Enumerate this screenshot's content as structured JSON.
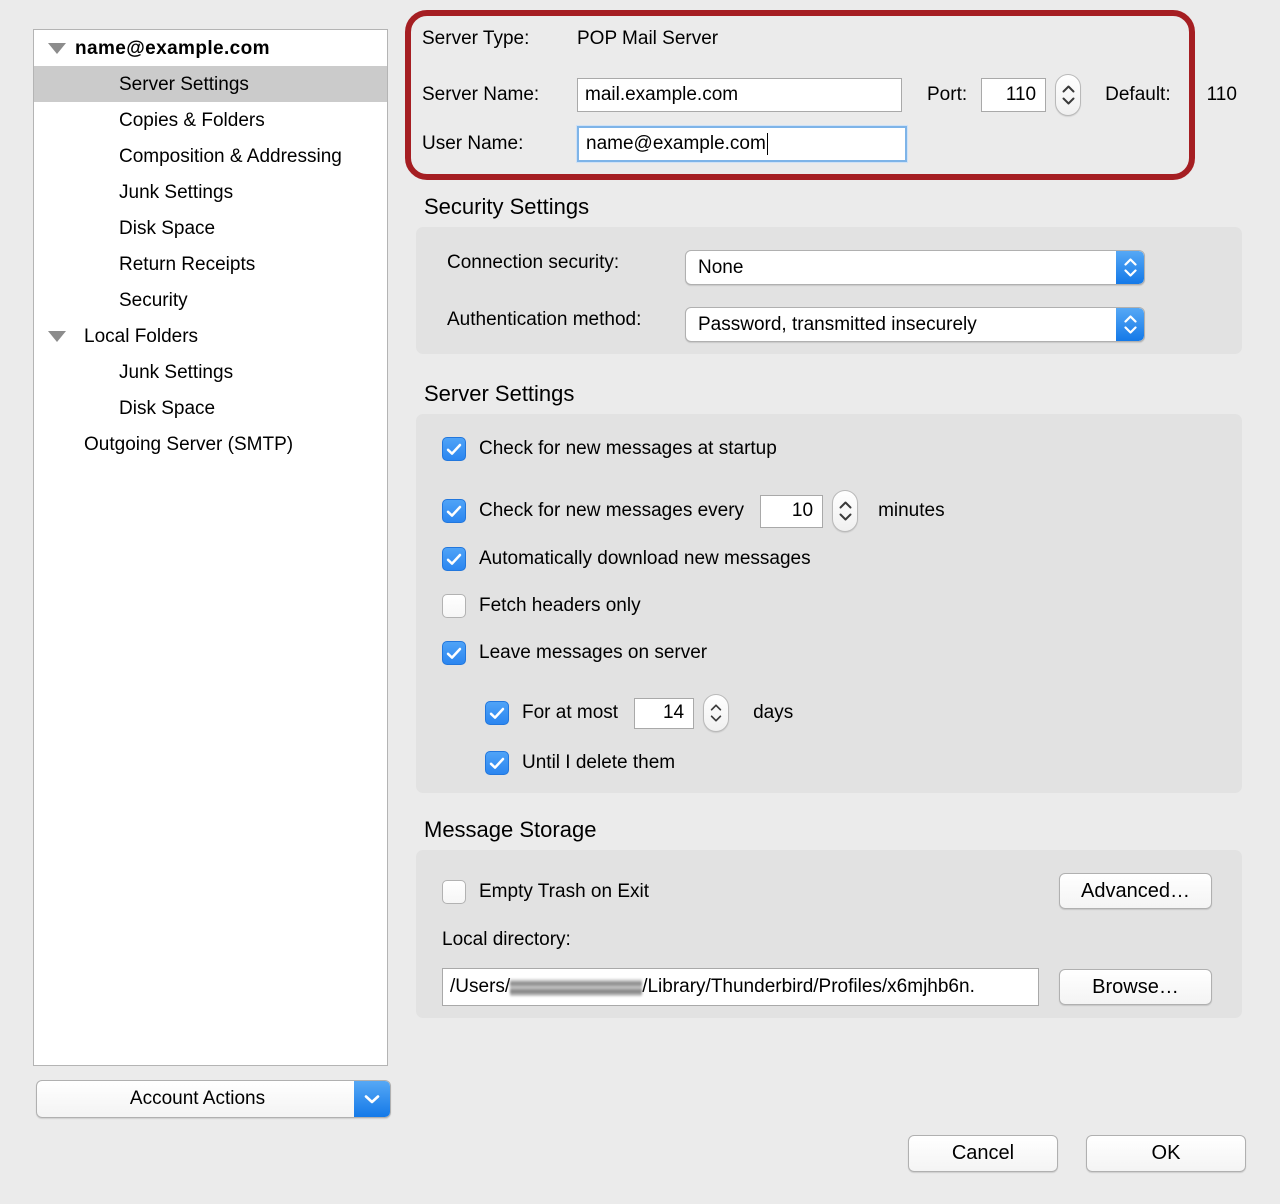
{
  "sidebar": {
    "tree_items": [
      {
        "label": "name@example.com",
        "level": "root",
        "twisty": true,
        "selected": false
      },
      {
        "label": "Server Settings",
        "level": "1",
        "twisty": false,
        "selected": true
      },
      {
        "label": "Copies & Folders",
        "level": "1",
        "twisty": false,
        "selected": false
      },
      {
        "label": "Composition & Addressing",
        "level": "1",
        "twisty": false,
        "selected": false
      },
      {
        "label": "Junk Settings",
        "level": "1",
        "twisty": false,
        "selected": false
      },
      {
        "label": "Disk Space",
        "level": "1",
        "twisty": false,
        "selected": false
      },
      {
        "label": "Return Receipts",
        "level": "1",
        "twisty": false,
        "selected": false
      },
      {
        "label": "Security",
        "level": "1",
        "twisty": false,
        "selected": false
      },
      {
        "label": "Local Folders",
        "level": "0",
        "twisty": true,
        "selected": false
      },
      {
        "label": "Junk Settings",
        "level": "1",
        "twisty": false,
        "selected": false
      },
      {
        "label": "Disk Space",
        "level": "1",
        "twisty": false,
        "selected": false
      },
      {
        "label": "Outgoing Server (SMTP)",
        "level": "0",
        "twisty": false,
        "selected": false
      }
    ],
    "account_actions_label": "Account Actions"
  },
  "server_identity": {
    "server_type_label": "Server Type:",
    "server_type_value": "POP Mail Server",
    "server_name_label": "Server Name:",
    "server_name_value": "mail.example.com",
    "port_label": "Port:",
    "port_value": "110",
    "default_label": "Default:",
    "default_value": "110",
    "user_name_label": "User Name:",
    "user_name_value": "name@example.com"
  },
  "security_settings": {
    "title": "Security Settings",
    "connection_security_label": "Connection security:",
    "connection_security_value": "None",
    "authentication_method_label": "Authentication method:",
    "authentication_method_value": "Password, transmitted insecurely"
  },
  "server_settings": {
    "title": "Server Settings",
    "check_at_startup_label": "Check for new messages at startup",
    "check_at_startup_checked": true,
    "check_every_label": "Check for new messages every",
    "check_every_checked": true,
    "check_every_value": "10",
    "check_every_unit": "minutes",
    "auto_download_label": "Automatically download new messages",
    "auto_download_checked": true,
    "fetch_headers_label": "Fetch headers only",
    "fetch_headers_checked": false,
    "leave_on_server_label": "Leave messages on server",
    "leave_on_server_checked": true,
    "for_at_most_label": "For at most",
    "for_at_most_checked": true,
    "for_at_most_value": "14",
    "for_at_most_unit": "days",
    "until_delete_label": "Until I delete them",
    "until_delete_checked": true
  },
  "message_storage": {
    "title": "Message Storage",
    "empty_trash_label": "Empty Trash on Exit",
    "empty_trash_checked": false,
    "advanced_button_label": "Advanced…",
    "local_directory_label": "Local directory:",
    "local_directory_prefix": "/Users/",
    "local_directory_suffix": "/Library/Thunderbird/Profiles/x6mjhb6n.",
    "browse_button_label": "Browse…"
  },
  "dialog_buttons": {
    "cancel_label": "Cancel",
    "ok_label": "OK"
  },
  "colors": {
    "highlight_border": "#a51e22",
    "accent_blue": "#2b86f0",
    "selection_gray": "#cbcbcb",
    "page_background": "#ebebeb",
    "group_background": "#e2e2e2"
  }
}
